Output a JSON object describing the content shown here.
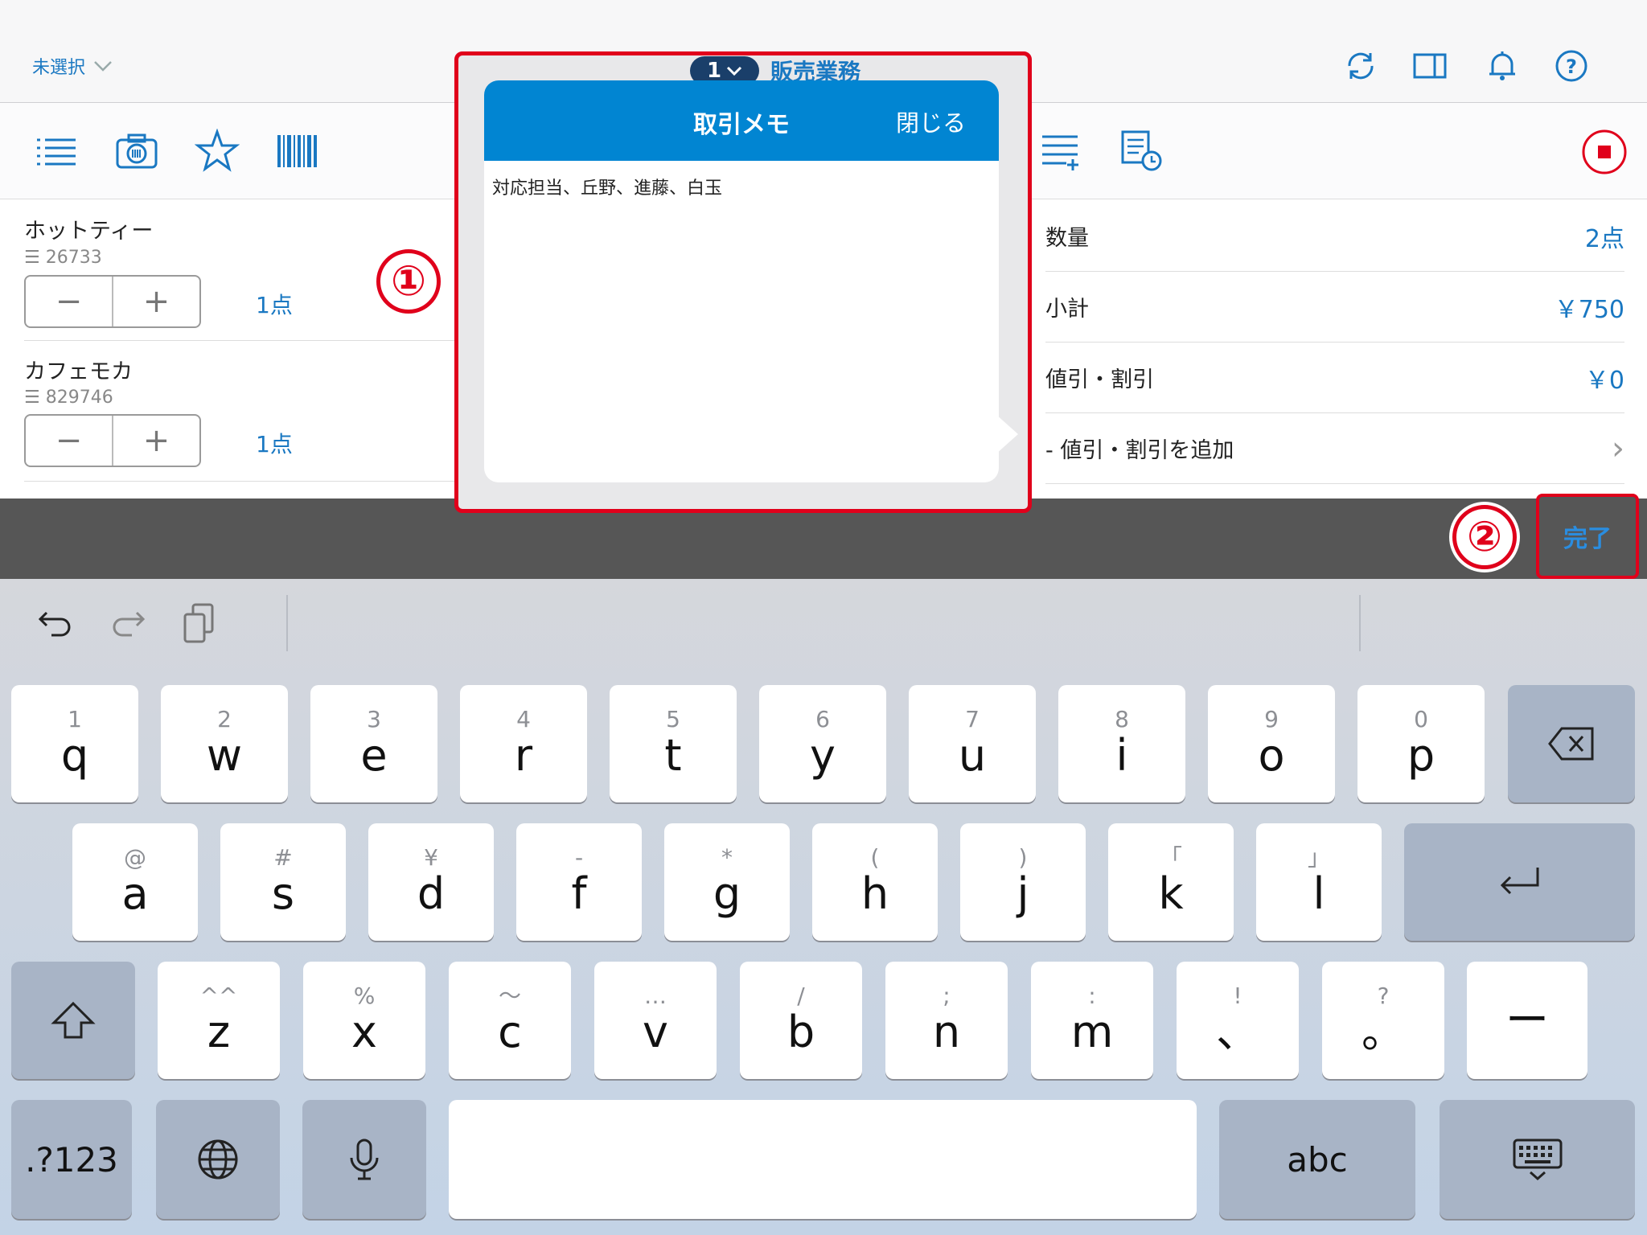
{
  "topbar": {
    "selector_label": "未選択",
    "icons": [
      "refresh-icon",
      "split-view-icon",
      "bell-icon",
      "help-icon"
    ]
  },
  "business": {
    "number": "1",
    "label": "販売業務"
  },
  "left_tools": [
    "list-icon",
    "camera-barcode-icon",
    "star-icon",
    "barcode-icon"
  ],
  "items": [
    {
      "name": "ホットティー",
      "code": "26733",
      "qty": "1点"
    },
    {
      "name": "カフェモカ",
      "code": "829746",
      "qty": "1点"
    }
  ],
  "summary": [
    {
      "label": "数量",
      "value": "2点"
    },
    {
      "label": "小計",
      "value": "￥750"
    },
    {
      "label": "値引・割引",
      "value": "￥0"
    },
    {
      "label": "- 値引・割引を追加",
      "value": "›"
    }
  ],
  "popover": {
    "title": "取引メモ",
    "close_label": "閉じる",
    "memo": "対応担当、丘野、進藤、白玉"
  },
  "callouts": {
    "one": "①",
    "two": "②"
  },
  "done_label": "完了",
  "keyboard": {
    "row1": [
      {
        "h": "1",
        "m": "q"
      },
      {
        "h": "2",
        "m": "w"
      },
      {
        "h": "3",
        "m": "e"
      },
      {
        "h": "4",
        "m": "r"
      },
      {
        "h": "5",
        "m": "t"
      },
      {
        "h": "6",
        "m": "y"
      },
      {
        "h": "7",
        "m": "u"
      },
      {
        "h": "8",
        "m": "i"
      },
      {
        "h": "9",
        "m": "o"
      },
      {
        "h": "0",
        "m": "p"
      }
    ],
    "row2": [
      {
        "h": "@",
        "m": "a"
      },
      {
        "h": "#",
        "m": "s"
      },
      {
        "h": "¥",
        "m": "d"
      },
      {
        "h": "-",
        "m": "f"
      },
      {
        "h": "*",
        "m": "g"
      },
      {
        "h": "(",
        "m": "h"
      },
      {
        "h": ")",
        "m": "j"
      },
      {
        "h": "「",
        "m": "k"
      },
      {
        "h": "」",
        "m": "l"
      }
    ],
    "row3": [
      {
        "h": "^^",
        "m": "z"
      },
      {
        "h": "%",
        "m": "x"
      },
      {
        "h": "〜",
        "m": "c"
      },
      {
        "h": "…",
        "m": "v"
      },
      {
        "h": "/",
        "m": "b"
      },
      {
        "h": ";",
        "m": "n"
      },
      {
        "h": ":",
        "m": "m"
      },
      {
        "h": "!",
        "m": "、"
      },
      {
        "h": "?",
        "m": "。"
      }
    ],
    "numbers_label": ".?123",
    "abc_label": "abc"
  }
}
